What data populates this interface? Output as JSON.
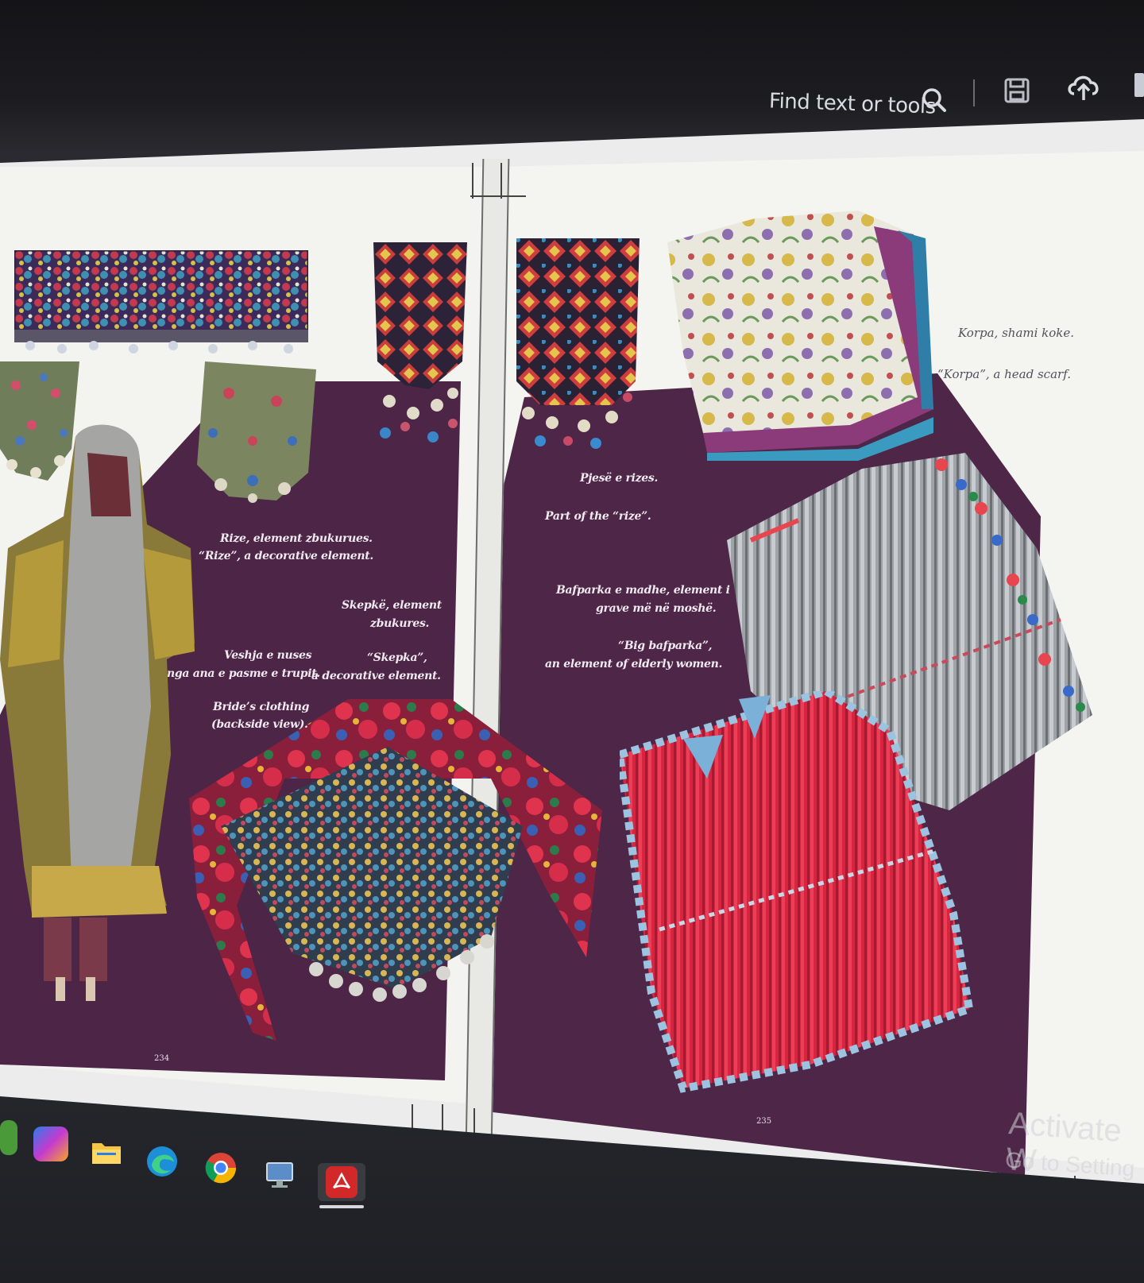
{
  "toolbar": {
    "search_placeholder": "Find text or tools",
    "search_icon": "search-icon",
    "save_icon": "save-icon",
    "upload_icon": "cloud-upload-icon"
  },
  "left_page": {
    "captions": {
      "rize_al": "Rize, element zbukurues.",
      "rize_en": "“Rize”, a decorative element.",
      "skepke_al_1": "Skepkë, element",
      "skepke_al_2": "zbukures.",
      "skepke_en_1": "“Skepka”,",
      "skepke_en_2": "a decorative element.",
      "veshja_1": "Veshja e nuses",
      "veshja_2": "nga ana e pasme e trupit.",
      "bride_1": "Bride’s clothing",
      "bride_2": "(backside view)."
    },
    "page_number": "234"
  },
  "right_page": {
    "captions": {
      "pjese_al": "Pjesë e rizes.",
      "pjese_en": "Part of the “rize”.",
      "bafpa_al_1": "Bafparka e madhe, element i",
      "bafpa_al_2": "grave më në moshë.",
      "bafpa_en_1": "“Big bafparka”,",
      "bafpa_en_2": "an element of elderly women.",
      "korpa_al": "Korpa, shami koke.",
      "korpa_en": "“Korpa”, a head scarf."
    },
    "page_number": "235"
  },
  "watermark": {
    "line1": "Activate W",
    "line2": "Go to Setting"
  },
  "taskbar": {
    "icons": [
      "widgets-icon",
      "copilot-icon",
      "file-explorer-icon",
      "edge-icon",
      "chrome-icon",
      "remote-desktop-icon",
      "acrobat-icon"
    ]
  },
  "colors": {
    "purple_bg": "#4c2547",
    "page_bg": "#f3f3f0",
    "acrobat_red": "#d3282a"
  }
}
